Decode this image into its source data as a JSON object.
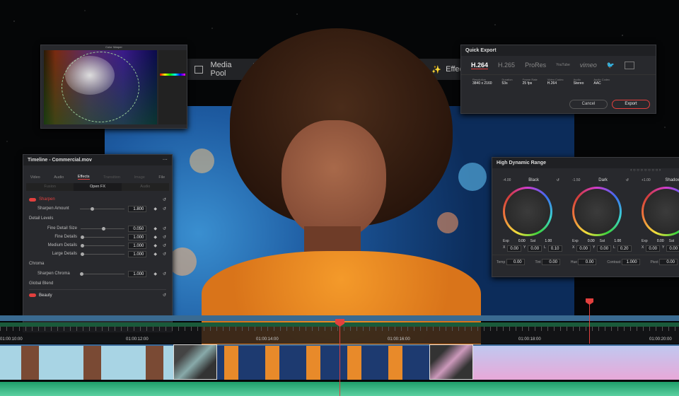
{
  "toolbar": {
    "media_pool": "Media Pool",
    "effects": "Effec"
  },
  "color_warper": {
    "title": "Color Warper"
  },
  "quick_export": {
    "title": "Quick Export",
    "formats": [
      "H.264",
      "H.265",
      "ProRes",
      "YouTube",
      "vimeo"
    ],
    "selected": "H.264",
    "fields": [
      {
        "label": "Resolution",
        "value": "3840 x 2160"
      },
      {
        "label": "Duration",
        "value": "53s"
      },
      {
        "label": "Frame Rate",
        "value": "25 fps"
      },
      {
        "label": "Video Codec",
        "value": "H.264"
      },
      {
        "label": "Audio",
        "value": "Stereo"
      },
      {
        "label": "Audio Codec",
        "value": "AAC"
      }
    ],
    "cancel": "Cancel",
    "export": "Export"
  },
  "inspector": {
    "title": "Timeline - Commercial.mov",
    "tabs": [
      "Video",
      "Audio",
      "Effects",
      "Transition",
      "Image",
      "File"
    ],
    "active_tab": "Effects",
    "subtabs": [
      "Fusion",
      "Open FX",
      "Audio"
    ],
    "effect1": "Sharpen",
    "sharpen_amount": {
      "label": "Sharpen Amount",
      "value": "1.800"
    },
    "detail_levels": "Detail Levels",
    "details": [
      {
        "label": "Fine Detail Size",
        "value": "0.050"
      },
      {
        "label": "Fine Details",
        "value": "1.000"
      },
      {
        "label": "Medium Details",
        "value": "1.000"
      },
      {
        "label": "Large Details",
        "value": "1.000"
      }
    ],
    "chroma": "Chroma",
    "sharpen_chroma": {
      "label": "Sharpen Chroma",
      "value": "1.000"
    },
    "global_blend": "Global Blend",
    "effect2": "Beauty"
  },
  "hdr": {
    "title": "High Dynamic Range",
    "wheels": [
      {
        "name": "Black",
        "zone": "-4.00",
        "exp": "0.00",
        "sat": "1.00",
        "x": "0.00",
        "y": "0.00",
        "z": "0.10"
      },
      {
        "name": "Dark",
        "zone": "-1.50",
        "exp": "0.00",
        "sat": "1.00",
        "x": "0.00",
        "y": "0.00",
        "z": "0.20"
      },
      {
        "name": "Shadow",
        "zone": "+1.00",
        "exp": "0.00",
        "sat": "",
        "x": "0.00",
        "y": "0.00",
        "z": ""
      }
    ],
    "exp_label": "Exp",
    "sat_label": "Sat",
    "x_label": "X",
    "y_label": "Y",
    "z_label": "L",
    "bottom": [
      {
        "label": "Temp",
        "value": "0.00"
      },
      {
        "label": "Tint",
        "value": "0.00"
      },
      {
        "label": "Hue",
        "value": "0.00"
      },
      {
        "label": "Contrast",
        "value": "1.000"
      },
      {
        "label": "Pivot",
        "value": "0.00"
      }
    ]
  },
  "timeline": {
    "timecodes": [
      "01:00:10:00",
      "01:00:12:00",
      "01:00:14:00",
      "01:00:16:00",
      "01:00:18:00",
      "01:00:20:00"
    ]
  },
  "colors": {
    "accent_red": "#e2403e",
    "audio_green": "#1f9e6a",
    "clip_blue": "#3a6a9a"
  }
}
